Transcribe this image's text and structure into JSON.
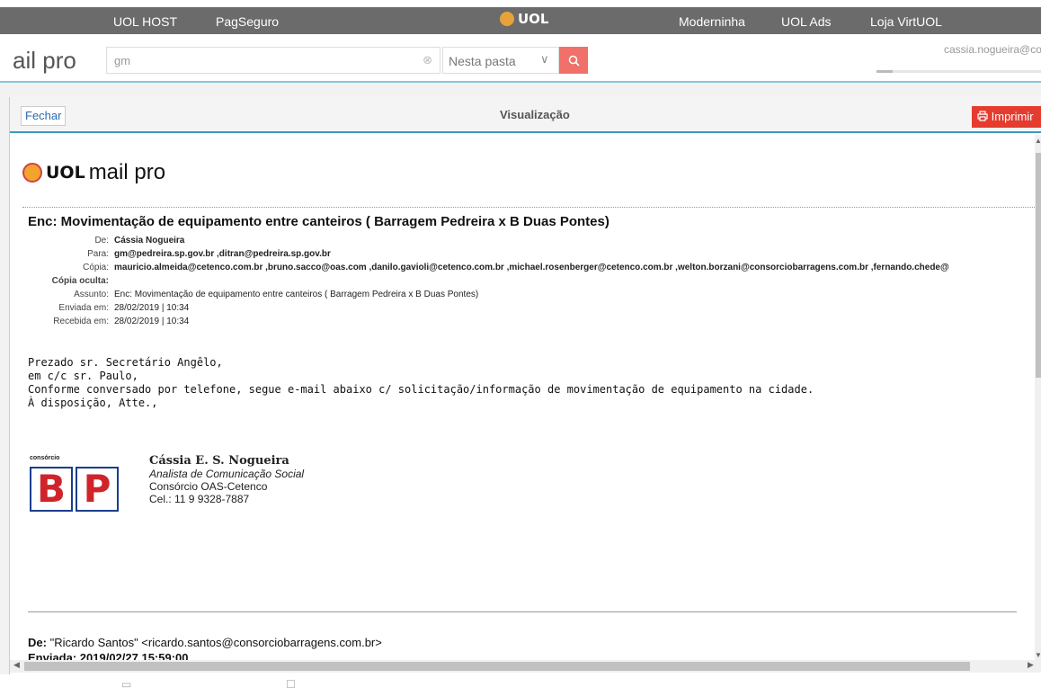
{
  "topbar": {
    "links": [
      "UOL HOST",
      "PagSeguro",
      "Moderninha",
      "UOL Ads",
      "Loja VirtUOL"
    ],
    "center_brand": "UOL"
  },
  "header": {
    "brand": "ail pro",
    "search": {
      "value": "gm",
      "placeholder": "gm"
    },
    "folder_select": "Nesta pasta",
    "user_email": "cassia.nogueira@co",
    "progress": 0.1
  },
  "dialog": {
    "close_label": "Fechar",
    "title": "Visualização",
    "print_label": "Imprimir"
  },
  "email": {
    "logo_uol": "UOL",
    "logo_text": "mail pro",
    "subject": "Enc: Movimentação de equipamento entre canteiros ( Barragem Pedreira x B Duas Pontes)",
    "meta": [
      {
        "label": "De:",
        "value": "Cássia Nogueira",
        "bold": true
      },
      {
        "label": "Para:",
        "value": "gm@pedreira.sp.gov.br  ,ditran@pedreira.sp.gov.br",
        "bold": true
      },
      {
        "label": "Cópia:",
        "value": "mauricio.almeida@cetenco.com.br  ,bruno.sacco@oas.com  ,danilo.gavioli@cetenco.com.br  ,michael.rosenberger@cetenco.com.br  ,welton.borzani@consorciobarragens.com.br  ,fernando.chede@",
        "bold": true
      },
      {
        "label": "Cópia oculta:",
        "value": "",
        "bold": true
      },
      {
        "label": "Assunto:",
        "value": "Enc: Movimentação de equipamento entre canteiros ( Barragem Pedreira x B Duas Pontes)",
        "bold": false
      },
      {
        "label": "Enviada em:",
        "value": "28/02/2019 | 10:34",
        "bold": false
      },
      {
        "label": "Recebida em:",
        "value": "28/02/2019 | 10:34",
        "bold": false
      }
    ],
    "body_lines": [
      "Prezado sr. Secretário Angêlo,",
      "em c/c sr. Paulo,",
      "Conforme conversado por telefone, segue e-mail abaixo c/ solicitação/informação de movimentação de equipamento na cidade.",
      "À disposição, Atte.,"
    ],
    "signature": {
      "logo_caption": "consórcio",
      "logo_letters": [
        "B",
        "P"
      ],
      "name": "Cássia E. S. Nogueira",
      "role": "Analista de Comunicação Social",
      "company": "Consórcio OAS-Cetenco",
      "phone": "Cel.: 11 9 9328-7887"
    },
    "forward": {
      "from_label": "De:",
      "from_value": "\"Ricardo Santos\" <ricardo.santos@consorciobarragens.com.br>",
      "next_line": "Enviada: 2019/02/27 15:59:00"
    }
  },
  "colors": {
    "topbar": "#6b6b6b",
    "accent_blue": "#3a9ac4",
    "print_red": "#e43c2f",
    "search_btn": "#f0706a"
  }
}
